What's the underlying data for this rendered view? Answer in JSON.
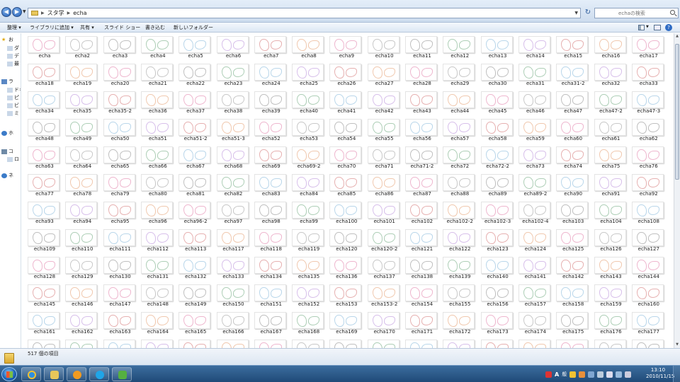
{
  "address": {
    "crumbs": [
      "スタ学",
      "echa"
    ],
    "search_placeholder": "echaの検索"
  },
  "toolbar": {
    "organize": "整理 ▾",
    "library": "ライブラリに追加 ▾",
    "share": "共有 ▾",
    "slideshow": "スライド ショー",
    "write": "書き込む",
    "new_folder": "新しいフォルダー"
  },
  "nav": [
    {
      "text": "お",
      "icon": "star-icon"
    },
    {
      "text": "ダ",
      "icon": "folder-icon"
    },
    {
      "text": "デ",
      "icon": "folder-icon"
    },
    {
      "text": "最",
      "icon": "folder-icon"
    },
    {
      "text": "ラ",
      "icon": "library-icon"
    },
    {
      "text": "ドキ",
      "icon": "library-icon"
    },
    {
      "text": "ピ",
      "icon": "library-icon"
    },
    {
      "text": "ビ",
      "icon": "library-icon"
    },
    {
      "text": "ミ",
      "icon": "library-icon"
    },
    {
      "text": "ホ",
      "icon": "homegroup-icon"
    },
    {
      "text": "コ",
      "icon": "computer-icon"
    },
    {
      "text": "ロ",
      "icon": "drive-icon"
    },
    {
      "text": "ネ",
      "icon": "network-icon"
    }
  ],
  "files": [
    "echa",
    "echa2",
    "echa3",
    "echa4",
    "echa5",
    "echa6",
    "echa7",
    "echa8",
    "echa9",
    "echa10",
    "echa11",
    "echa12",
    "echa13",
    "echa14",
    "echa15",
    "echa16",
    "echa17",
    "echa18",
    "echa19",
    "echa20",
    "echa21",
    "echa22",
    "echa23",
    "echa24",
    "echa25",
    "echa26",
    "echa27",
    "echa28",
    "echa29",
    "echa30",
    "echa31",
    "echa31-2",
    "echa32",
    "echa33",
    "echa34",
    "echa35",
    "echa35-2",
    "echa36",
    "echa37",
    "echa38",
    "echa39",
    "echa40",
    "echa41",
    "echa42",
    "echa43",
    "echa44",
    "echa45",
    "echa46",
    "echa47",
    "echa47-2",
    "echa47-3",
    "echa48",
    "echa49",
    "echa50",
    "echa51",
    "echa51-2",
    "echa51-3",
    "echa52",
    "echa53",
    "echa54",
    "echa55",
    "echa56",
    "echa57",
    "echa58",
    "echa59",
    "echa60",
    "echa61",
    "echa62",
    "echa63",
    "echa64",
    "echa65",
    "echa66",
    "echa67",
    "echa68",
    "echa69",
    "echa69-2",
    "echa70",
    "echa71",
    "echa71-2",
    "echa72",
    "echa72-2",
    "echa73",
    "echa74",
    "echa75",
    "echa76",
    "echa77",
    "echa78",
    "echa79",
    "echa80",
    "echa81",
    "echa82",
    "echa83",
    "echa84",
    "echa85",
    "echa86",
    "echa87",
    "echa88",
    "echa89",
    "echa89-2",
    "echa90",
    "echa91",
    "echa92",
    "echa93",
    "echa94",
    "echa95",
    "echa96",
    "echa96-2",
    "echa97",
    "echa98",
    "echa99",
    "echa100",
    "echa101",
    "echa102",
    "echa102-2",
    "echa102-3",
    "echa102-4",
    "echa103",
    "echa104",
    "echa108",
    "echa109",
    "echa110",
    "echa111",
    "echa112",
    "echa113",
    "echa117",
    "echa118",
    "echa119",
    "echa120",
    "echa120-2",
    "echa121",
    "echa122",
    "echa123",
    "echa124",
    "echa125",
    "echa126",
    "echa127",
    "echa128",
    "echa129",
    "echa130",
    "echa131",
    "echa132",
    "echa133",
    "echa134",
    "echa135",
    "echa136",
    "echa137",
    "echa138",
    "echa139",
    "echa140",
    "echa141",
    "echa142",
    "echa143",
    "echa144",
    "echa145",
    "echa146",
    "echa147",
    "echa148",
    "echa149",
    "echa150",
    "echa151",
    "echa152",
    "echa153",
    "echa153-2",
    "echa154",
    "echa155",
    "echa156",
    "echa157",
    "echa158",
    "echa159",
    "echa160",
    "echa161",
    "echa162",
    "echa163",
    "echa164",
    "echa165",
    "echa166",
    "echa167",
    "echa168",
    "echa169",
    "echa170",
    "echa171",
    "echa172",
    "echa173",
    "echa174",
    "echa175",
    "echa176",
    "echa177",
    "",
    "",
    "",
    "",
    "",
    "",
    "",
    "",
    "",
    "",
    "",
    "",
    "",
    "",
    "",
    "",
    ""
  ],
  "status": {
    "item_count": "517 個の項目"
  },
  "clock": {
    "time": "13:10",
    "date": "2010/11/15"
  },
  "tray": {
    "ime_mode": "A",
    "ime_kanji": "般"
  },
  "colors": {
    "thumb_strokes": [
      "#e07aa6",
      "#b78ad8",
      "#8a8a8a",
      "#e39b6b",
      "#7fb4d9",
      "#9b9b9b",
      "#d27070",
      "#6aa57a"
    ]
  }
}
